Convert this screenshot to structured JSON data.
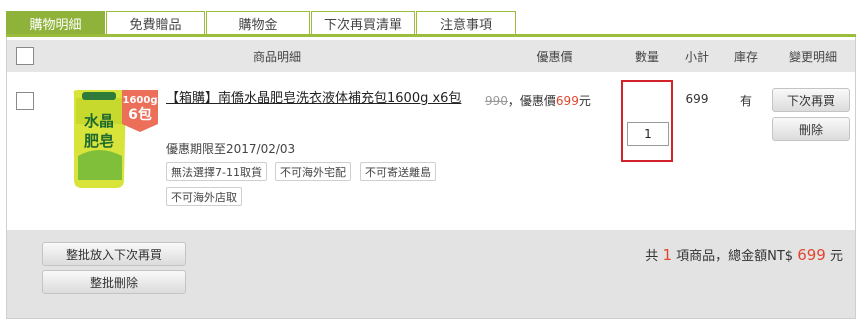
{
  "tabs": [
    {
      "label": "購物明細",
      "active": true
    },
    {
      "label": "免費贈品",
      "active": false
    },
    {
      "label": "購物金",
      "active": false
    },
    {
      "label": "下次再買清單",
      "active": false
    },
    {
      "label": "注意事項",
      "active": false
    }
  ],
  "table": {
    "headers": {
      "product": "商品明細",
      "price": "優惠價",
      "qty": "數量",
      "subtotal": "小計",
      "stock": "庫存",
      "change": "變更明細"
    }
  },
  "item": {
    "badge": {
      "line1": "1600g",
      "line2": "6包"
    },
    "image_text": "水晶肥皂",
    "name": "【箱購】南僑水晶肥皂洗衣液体補充包1600g x6包",
    "original_price": "990",
    "discount_label": "，優惠價",
    "discount_price": "699",
    "currency_suffix": "元",
    "promo_period": "優惠期限至2017/02/03",
    "tags": [
      "無法選擇7-11取貨",
      "不可海外宅配",
      "不可寄送離島",
      "不可海外店取"
    ],
    "quantity": "1",
    "subtotal": "699",
    "stock": "有",
    "buy_later_label": "下次再買",
    "delete_label": "刪除"
  },
  "footer": {
    "batch_buy_later": "整批放入下次再買",
    "batch_delete": "整批刪除",
    "summary_prefix": "共",
    "item_count": "1",
    "summary_mid": "項商品，總金額NT$",
    "total": "699",
    "summary_suffix": "元"
  },
  "colors": {
    "tab_active": "#8fb33a",
    "tab_border": "#9bbd3c",
    "price_red": "#e2462f",
    "highlight_box": "#d2232a"
  }
}
